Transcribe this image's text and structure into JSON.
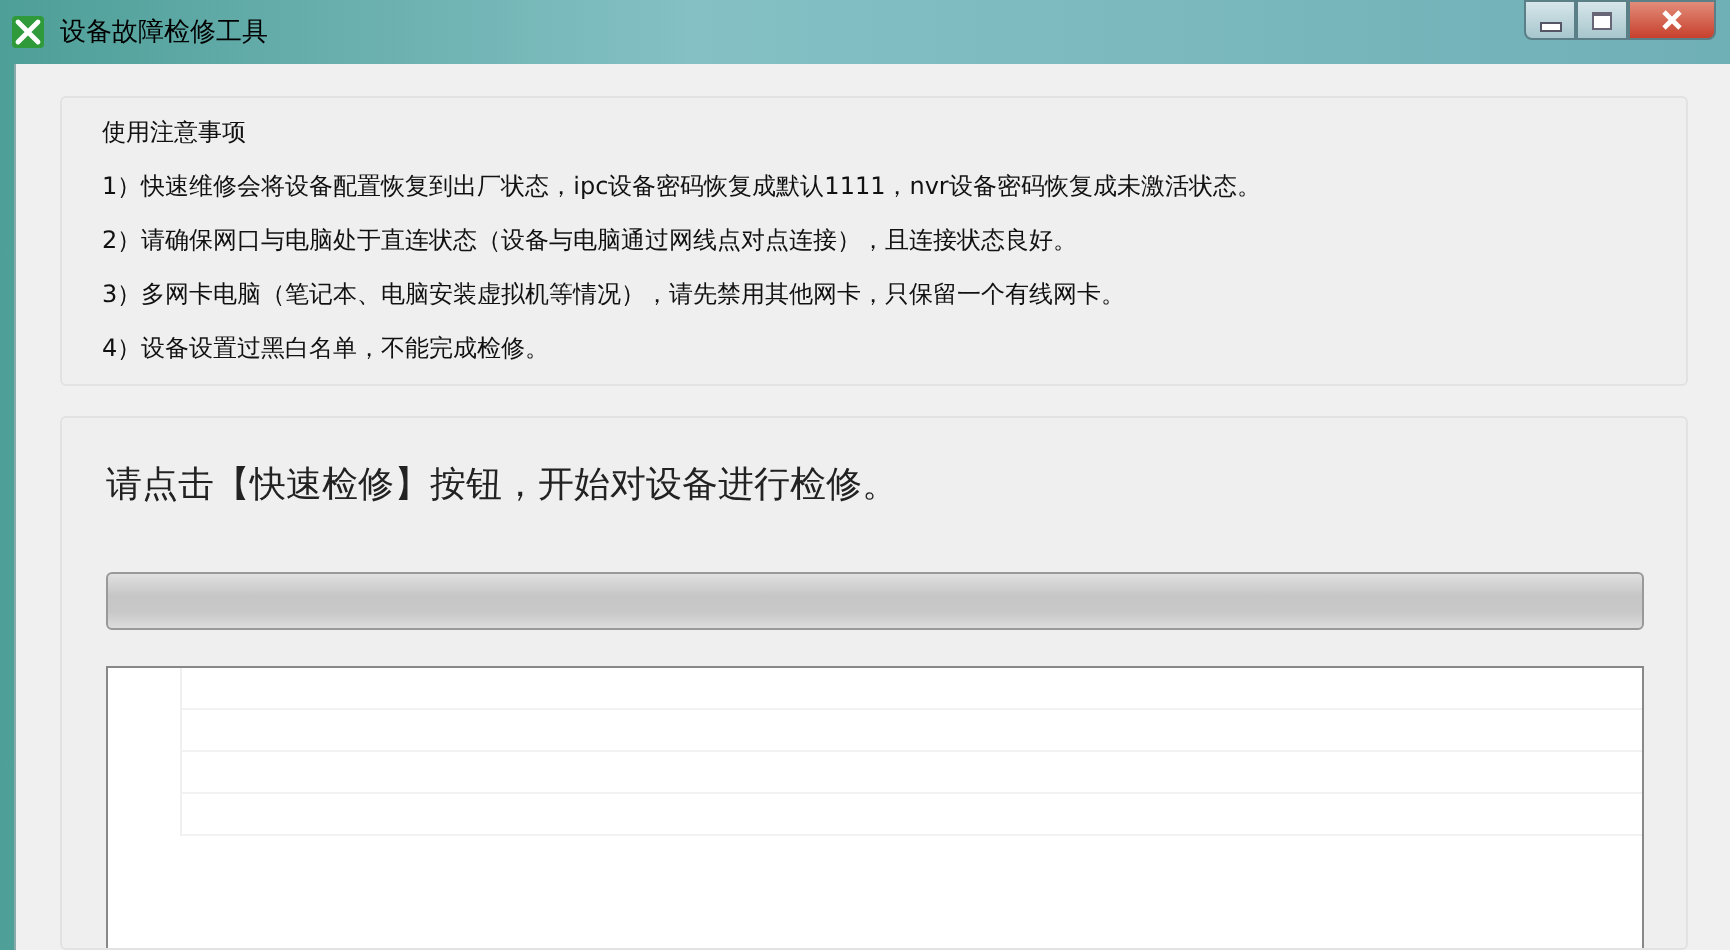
{
  "window": {
    "title": "设备故障检修工具"
  },
  "notes": {
    "title": "使用注意事项",
    "items": [
      "1）快速维修会将设备配置恢复到出厂状态，ipc设备密码恢复成默认1111，nvr设备密码恢复成未激活状态。",
      "2）请确保网口与电脑处于直连状态（设备与电脑通过网线点对点连接），且连接状态良好。",
      "3）多网卡电脑（笔记本、电脑安装虚拟机等情况），请先禁用其他网卡，只保留一个有线网卡。",
      "4）设备设置过黑白名单，不能完成检修。"
    ]
  },
  "repair": {
    "instruction": "请点击【快速检修】按钮，开始对设备进行检修。",
    "progress": {
      "level": 0
    }
  }
}
